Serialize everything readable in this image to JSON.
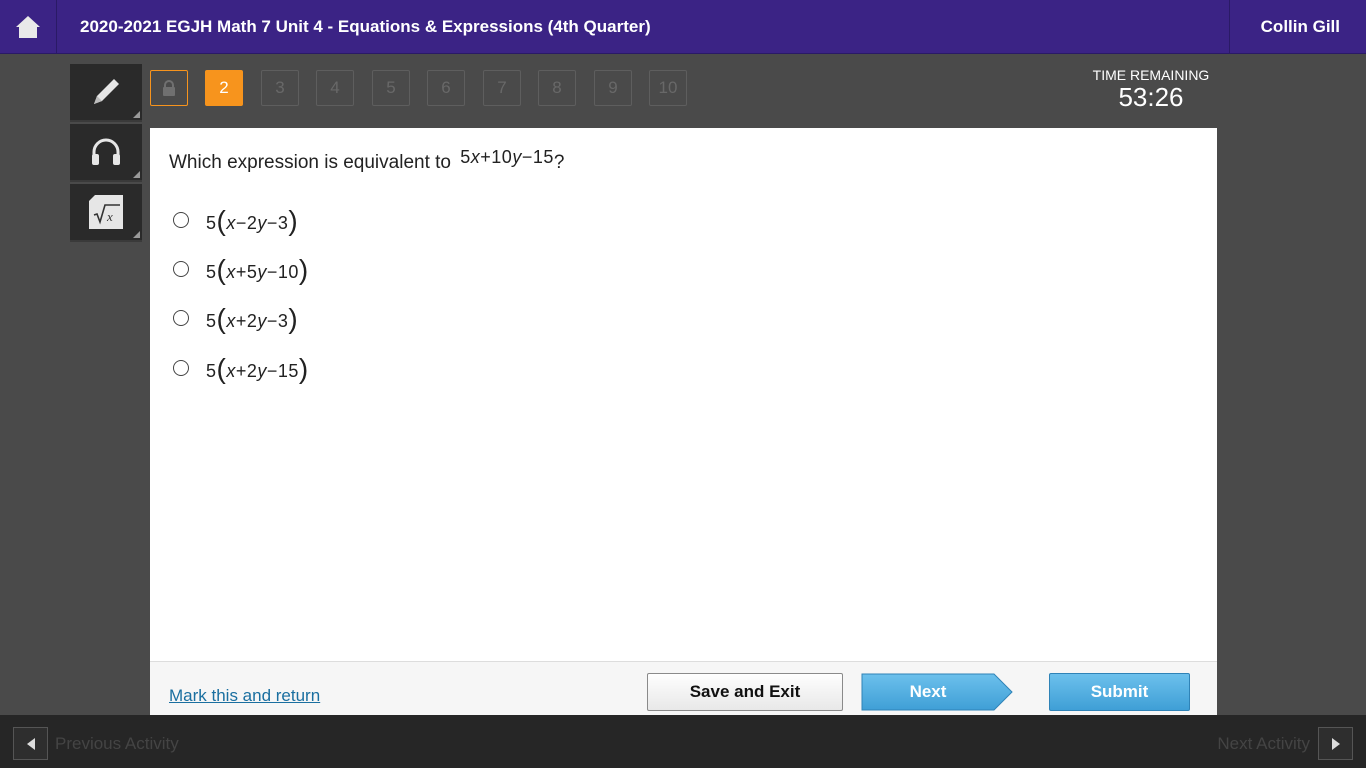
{
  "header": {
    "course_title": "2020-2021 EGJH Math 7 Unit 4 - Equations & Expressions (4th Quarter)",
    "user_name": "Collin Gill"
  },
  "tools": [
    "pencil-icon",
    "headphones-icon",
    "math-sqrt-icon"
  ],
  "question_nav": {
    "locked_item": "lock-icon",
    "current": "2",
    "items": [
      "3",
      "4",
      "5",
      "6",
      "7",
      "8",
      "9",
      "10"
    ]
  },
  "timer": {
    "label": "TIME REMAINING",
    "value": "53:26"
  },
  "question": {
    "text": "Which expression is equivalent to",
    "expr": {
      "c1": "5",
      "v1": "x",
      "op1": "+",
      "c2": "10",
      "v2": "y",
      "op2": "−",
      "c3": "15"
    },
    "end": "?"
  },
  "options": [
    {
      "coef": "5",
      "lparen": "(",
      "v1": "x",
      "op1": "−",
      "c2": "2",
      "v2": "y",
      "op2": "−",
      "c3": "3",
      "rparen": ")"
    },
    {
      "coef": "5",
      "lparen": "(",
      "v1": "x",
      "op1": "+",
      "c2": "5",
      "v2": "y",
      "op2": "−",
      "c3": "10",
      "rparen": ")"
    },
    {
      "coef": "5",
      "lparen": "(",
      "v1": "x",
      "op1": "+",
      "c2": "2",
      "v2": "y",
      "op2": "−",
      "c3": "3",
      "rparen": ")"
    },
    {
      "coef": "5",
      "lparen": "(",
      "v1": "x",
      "op1": "+",
      "c2": "2",
      "v2": "y",
      "op2": "−",
      "c3": "15",
      "rparen": ")"
    }
  ],
  "footer": {
    "mark_link": "Mark this and return",
    "save_exit": "Save and Exit",
    "next": "Next",
    "submit": "Submit"
  },
  "activity_nav": {
    "previous": "Previous Activity",
    "next": "Next Activity"
  },
  "colors": {
    "header_bg": "#3b2385",
    "current_question": "#f7941d",
    "primary_button": "#4aa8dd",
    "link": "#1a6fa0"
  }
}
